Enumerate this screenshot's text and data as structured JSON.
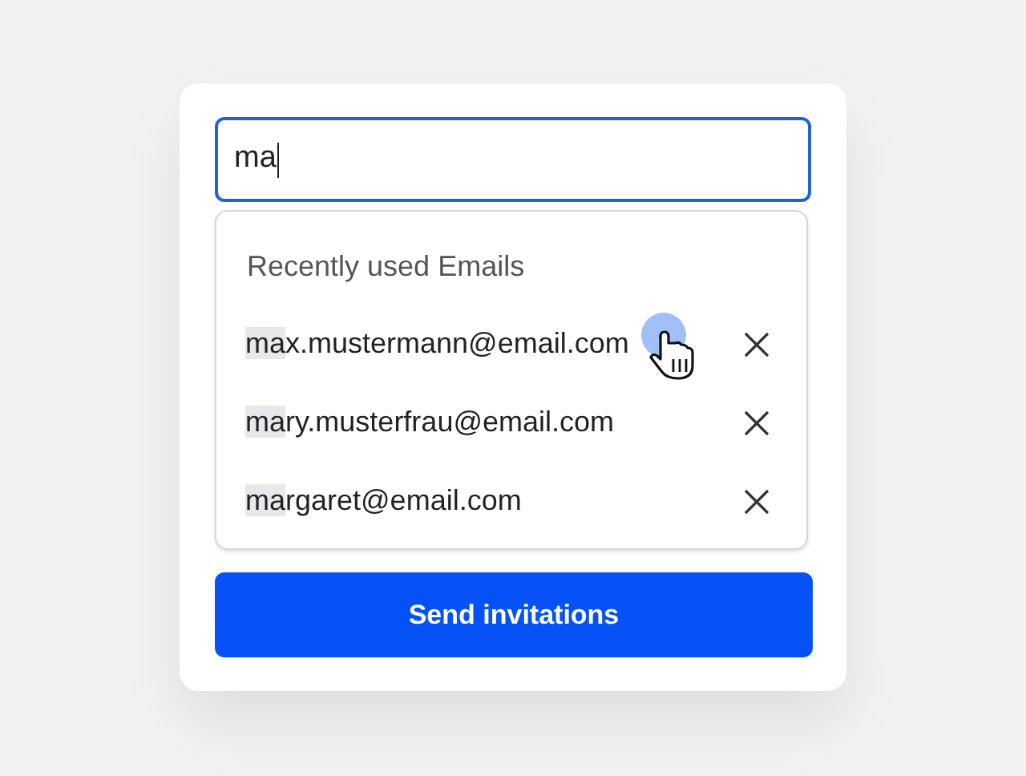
{
  "input": {
    "value": "ma",
    "focused": true
  },
  "dropdown": {
    "heading": "Recently used Emails",
    "items": [
      {
        "match": "ma",
        "rest": "x.mustermann@email.com",
        "hovered": true
      },
      {
        "match": "ma",
        "rest": "ry.musterfrau@email.com",
        "hovered": false
      },
      {
        "match": "ma",
        "rest": "rgaret@email.com",
        "hovered": false
      }
    ]
  },
  "button": {
    "label": "Send invitations"
  }
}
